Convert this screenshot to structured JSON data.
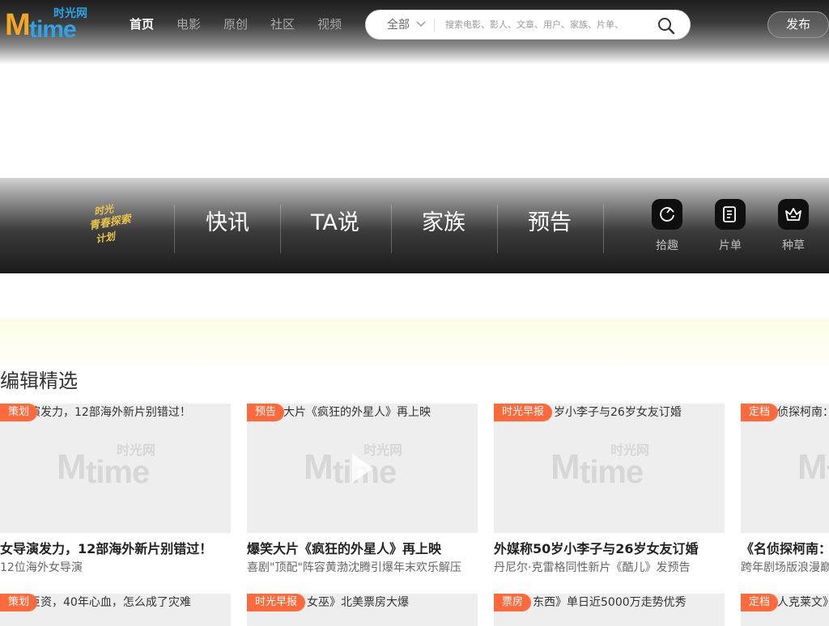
{
  "header": {
    "logo": {
      "m": "M",
      "time": "time",
      "cn": "时光网"
    },
    "nav": [
      "首页",
      "电影",
      "原创",
      "社区",
      "视频"
    ],
    "search": {
      "category": "全部",
      "placeholder": "搜索电影、影人、文章、用户、家族、片单、"
    },
    "publish": "发布"
  },
  "category_bar": {
    "badge_text": [
      "时光",
      "青春探索",
      "计划"
    ],
    "categories": [
      "快讯",
      "TA说",
      "家族",
      "预告"
    ],
    "icon_buttons": [
      {
        "label": "拾趣",
        "icon": "moon-icon"
      },
      {
        "label": "片单",
        "icon": "list-icon"
      },
      {
        "label": "种草",
        "icon": "crown-icon"
      }
    ]
  },
  "section": {
    "title": "编辑精选"
  },
  "cards_row1": [
    {
      "tag": "策划",
      "caption": "演发力，12部海外新片别错过！",
      "title": "女导演发力，12部海外新片别错过！",
      "subtitle": "12位海外女导演",
      "has_play": false
    },
    {
      "tag": "预告",
      "caption": "大片《疯狂的外星人》再上映",
      "title": "爆笑大片《疯狂的外星人》再上映",
      "subtitle": "喜剧\"顶配\"阵容黄渤沈腾引爆年末欢乐解压",
      "has_play": true
    },
    {
      "tag": "时光早报",
      "caption": "岁小李子与26岁女友订婚",
      "title": "外媒称50岁小李子与26岁女友订婚",
      "subtitle": "丹尼尔·克雷格同性新片《酷儿》发预告",
      "has_play": false
    },
    {
      "tag": "定档",
      "caption": "侦探柯南：",
      "title": "《名侦探柯南：",
      "subtitle": "跨年剧场版浪漫巅",
      "has_play": false
    }
  ],
  "cards_row2": [
    {
      "tag": "策划",
      "caption": "巨资，40年心血，怎么成了灾难"
    },
    {
      "tag": "时光早报",
      "caption": "女巫》北美票房大爆"
    },
    {
      "tag": "票房",
      "caption": "东西》单日近5000万走势优秀"
    },
    {
      "tag": "定档",
      "caption": "人克莱文》"
    }
  ],
  "colors": {
    "tag": "#ff6a3d",
    "thumb_bg": "#eeeeee",
    "logo_orange": "#f5a623",
    "logo_blue": "#2ea3e6"
  }
}
